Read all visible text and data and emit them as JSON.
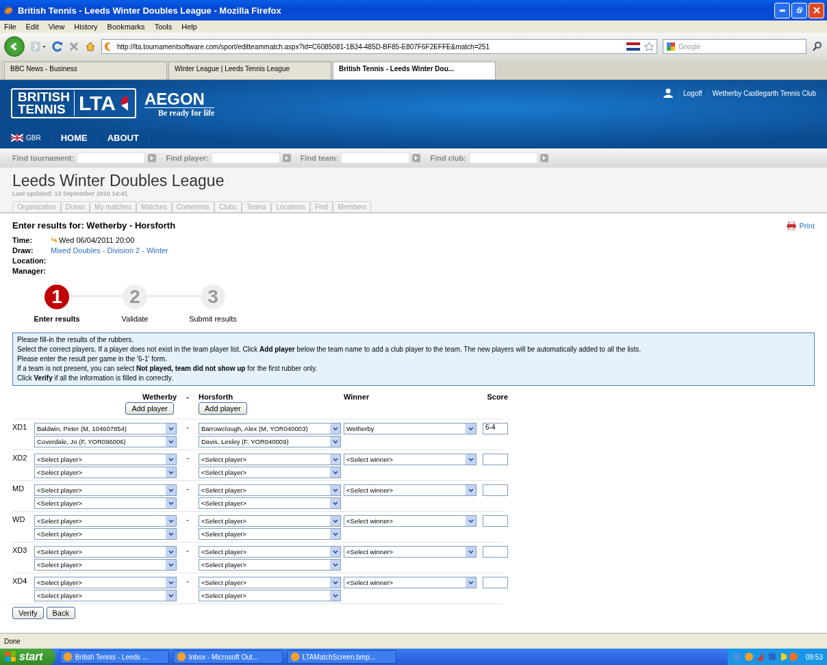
{
  "window": {
    "title": "British Tennis - Leeds Winter Doubles League - Mozilla Firefox"
  },
  "menu": [
    "File",
    "Edit",
    "View",
    "History",
    "Bookmarks",
    "Tools",
    "Help"
  ],
  "toolbar": {
    "url": "http://lta.tournamentsoftware.com/sport/editteammatch.aspx?id=C6085081-1B34-485D-BF85-E807F6F2EFFE&match=251",
    "search_placeholder": "Google"
  },
  "browser_tabs": [
    {
      "label": "BBC News - Business",
      "selected": false
    },
    {
      "label": "Winter League | Leeds Tennis League",
      "selected": false
    },
    {
      "label": "British Tennis - Leeds Winter Dou...",
      "selected": true
    }
  ],
  "site": {
    "logo_lines": [
      "BRITISH",
      "TENNIS"
    ],
    "logo_lta": "LTA",
    "sponsor": "AEGON",
    "tagline": "Be ready for life",
    "user_links": [
      "Logoff",
      "Wetherby Castlegarth Tennis Club"
    ],
    "country": "GBR",
    "nav": [
      "HOME",
      "ABOUT"
    ],
    "find": [
      "Find tournament:",
      "Find player:",
      "Find team:",
      "Find club:"
    ],
    "title": "Leeds Winter Doubles League",
    "last_updated": "Last updated: 13 September 2010 14:41",
    "tabs": [
      "Organization",
      "Draws",
      "My matches",
      "Matches",
      "Comments",
      "Clubs",
      "Teams",
      "Locations",
      "Find",
      "Members"
    ]
  },
  "heading": "Enter results for: Wetherby - Horsforth",
  "print": "Print",
  "details": [
    {
      "label": "Time:",
      "value": "Wed 06/04/2011 20:00",
      "kind": "time"
    },
    {
      "label": "Draw:",
      "value": "Mixed Doubles - Division 2 - Winter",
      "kind": "link"
    },
    {
      "label": "Location:",
      "kind": "text"
    },
    {
      "label": "Manager:",
      "kind": "text"
    }
  ],
  "steps": [
    {
      "number": "1",
      "label": "Enter results",
      "selected": true
    },
    {
      "number": "2",
      "label": "Validate",
      "selected": false
    },
    {
      "number": "3",
      "label": "Submit results",
      "selected": false
    }
  ],
  "instructions": [
    "Please fill-in the results of the rubbers.",
    "Select the correct players. If a player does not exist in the team player list. Click **Add player** below the team name to add a club player to the team. The new players will be automatically added to all the lists.",
    "Please enter the result per game in the '6-1' form.",
    "If a team is not present, you can select **Not played, team did not show up** for the first rubber only.",
    "Click **Verify** if all the information is filled in correctly."
  ],
  "table": {
    "home": "Wetherby",
    "separator": "-",
    "away": "Horsforth",
    "winner": "Winner",
    "score": "Score",
    "add_player": [
      "Add player",
      "Add player"
    ]
  },
  "rubbers": [
    {
      "code": "XD1",
      "home": [
        "Baldwin, Peter (M, 104607854)",
        "Coverdale, Jo (F, YOR096006)"
      ],
      "away": [
        "Barrowclough, Alex (M, YOR040003)",
        "Davis, Lesley (F, YOR040009)"
      ],
      "winner": "Wetherby",
      "score": "6-4"
    },
    {
      "code": "XD2",
      "home": [
        "<Select player>",
        "<Select player>"
      ],
      "away": [
        "<Select player>",
        "<Select player>"
      ],
      "winner": "<Select winner>"
    },
    {
      "code": "MD",
      "home": [
        "<Select player>",
        "<Select player>"
      ],
      "away": [
        "<Select player>",
        "<Select player>"
      ],
      "winner": "<Select winner>"
    },
    {
      "code": "WD",
      "home": [
        "<Select player>",
        "<Select player>"
      ],
      "away": [
        "<Select player>",
        "<Select player>"
      ],
      "winner": "<Select winner>"
    },
    {
      "code": "XD3",
      "home": [
        "<Select player>",
        "<Select player>"
      ],
      "away": [
        "<Select player>",
        "<Select player>"
      ],
      "winner": "<Select winner>"
    },
    {
      "code": "XD4",
      "home": [
        "<Select player>",
        "<Select player>"
      ],
      "away": [
        "<Select player>",
        "<Select player>"
      ],
      "winner": "<Select winner>"
    }
  ],
  "actions": [
    "Verify",
    "Back"
  ],
  "status": "Done",
  "taskbar": {
    "start": "start",
    "tasks": [
      "British Tennis - Leeds ...",
      "Inbox - Microsoft Out...",
      "LTAMatchScreen.bmp..."
    ],
    "clock": "09:53"
  }
}
